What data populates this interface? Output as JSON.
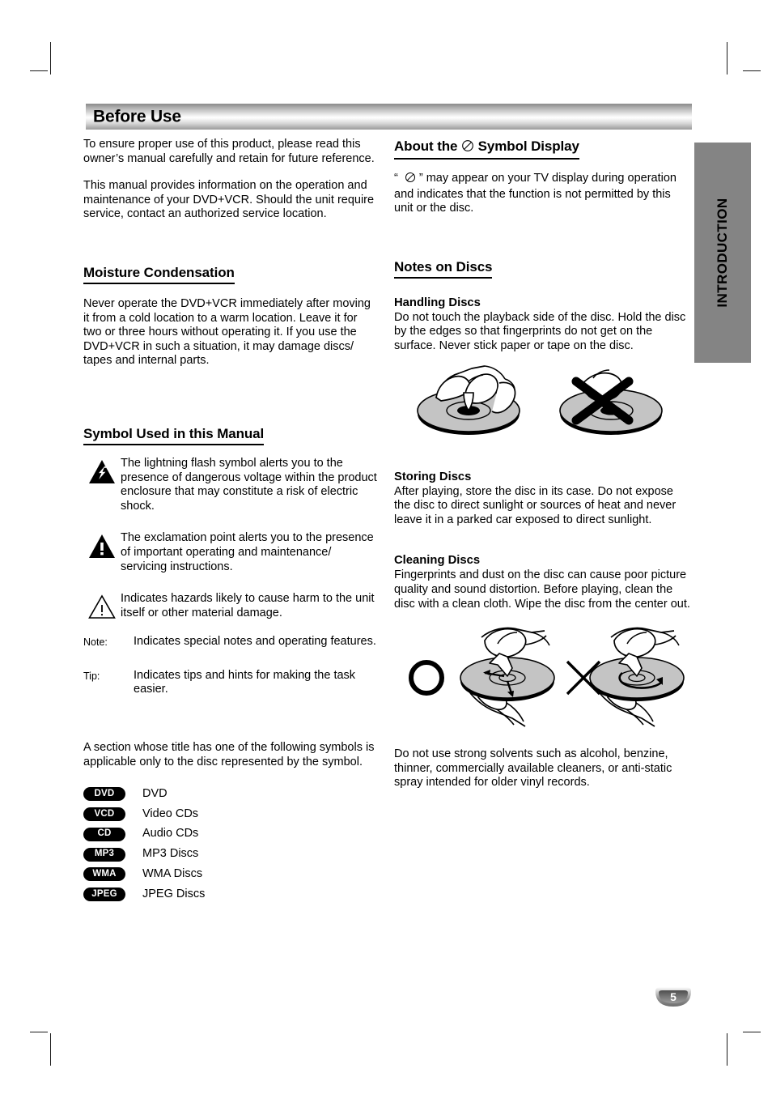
{
  "page": {
    "header_title": "Before Use",
    "side_tab_label": "INTRODUCTION",
    "page_number": "5",
    "colors": {
      "side_tab_bg": "#848484",
      "badge_bg": "#000000",
      "disc_grey": "#c4c4c4",
      "header_gradient_light": "#ffffff",
      "header_gradient_dark": "#8a8a8a"
    }
  },
  "left_column": {
    "intro_paragraph_1": "To ensure proper use of this product, please read this owner’s manual carefully and retain for future reference.",
    "intro_paragraph_2": "This manual provides information on the operation and maintenance of your DVD+VCR. Should the unit require service, contact an authorized service location.",
    "moisture": {
      "heading": "Moisture Condensation",
      "paragraph": "Never operate the DVD+VCR immediately after moving it from a cold location to a warm location. Leave it for two or three hours without operating it. If you use the DVD+VCR in such a situation, it may damage discs/ tapes and internal parts."
    },
    "symbols": {
      "heading": "Symbol Used in this Manual",
      "items": [
        {
          "icon": "lightning-bolt-triangle-icon",
          "text": "The lightning flash symbol alerts you to the presence of dangerous voltage within the product enclosure that may constitute a risk of electric shock."
        },
        {
          "icon": "exclamation-triangle-filled-icon",
          "text": "The exclamation point alerts you to the presence of important operating and maintenance/ servicing instructions."
        },
        {
          "icon": "exclamation-triangle-outline-icon",
          "text": "Indicates hazards likely to cause harm to the unit itself or other material damage."
        }
      ],
      "note_rows": [
        {
          "label": "Note:",
          "text": "Indicates special notes and operating features."
        },
        {
          "label": "Tip:",
          "text": "Indicates tips and hints for making the task easier."
        }
      ]
    },
    "disc_section": {
      "paragraph": "A section whose title has one of the following symbols is applicable only to the disc represented by the symbol.",
      "items": [
        {
          "badge": "DVD",
          "label": "DVD"
        },
        {
          "badge": "VCD",
          "label": "Video CDs"
        },
        {
          "badge": "CD",
          "label": "Audio CDs"
        },
        {
          "badge": "MP3",
          "label": "MP3 Discs"
        },
        {
          "badge": "WMA",
          "label": "WMA Discs"
        },
        {
          "badge": "JPEG",
          "label": "JPEG Discs"
        }
      ]
    }
  },
  "right_column": {
    "about_symbol": {
      "heading_before": "About the",
      "heading_after": "Symbol Display",
      "symbol_icon": "prohibition-circle-slash-icon",
      "paragraph_before": "“",
      "paragraph_after": "” may appear on your TV display during operation and indicates that the function is not permitted by this unit or the disc."
    },
    "notes_on_discs": {
      "heading": "Notes on Discs",
      "handling": {
        "heading": "Handling Discs",
        "paragraph": "Do not touch the playback side of the disc. Hold the disc by the edges so that fingerprints do not get on the surface. Never stick paper or tape on the disc.",
        "illustration": "hand-holding-disc-correct-and-crossed-out-incorrect"
      },
      "storing": {
        "heading": "Storing Discs",
        "paragraph": "After playing, store the disc in its case. Do not expose the disc to direct sunlight or sources of heat and never leave it in a parked car exposed to direct sunlight."
      },
      "cleaning": {
        "heading": "Cleaning Discs",
        "paragraph": "Fingerprints and dust on the disc can cause poor picture quality and sound distortion. Before playing, clean the disc with a clean cloth. Wipe the disc from the center out.",
        "illustration": "wipe-disc-center-out-correct-circle-and-circular-wipe-incorrect-cross",
        "footer_paragraph": "Do not use strong solvents such as alcohol, benzine, thinner, commercially available cleaners, or anti-static spray intended for older vinyl records."
      }
    }
  }
}
